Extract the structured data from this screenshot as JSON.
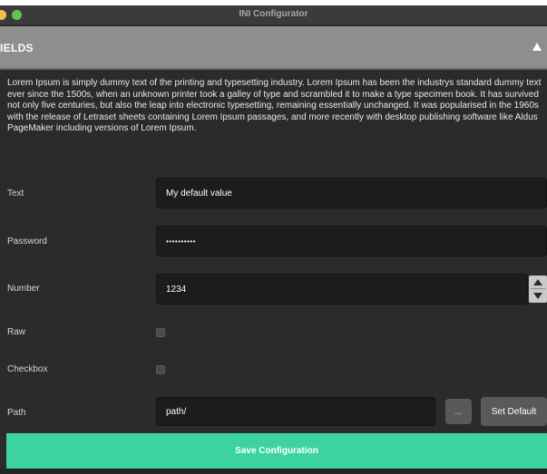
{
  "window": {
    "title": "INI Configurator"
  },
  "section": {
    "title": "IELDS"
  },
  "description": "Lorem Ipsum is simply dummy text of the printing and typesetting industry. Lorem Ipsum has been the industrys standard dummy text ever since the 1500s, when an unknown printer took a galley of type and scrambled it to make a type specimen book. It has survived not only five centuries, but also the leap into electronic typesetting, remaining essentially unchanged. It was popularised in the 1960s with the release of Letraset sheets containing Lorem Ipsum passages, and more recently with desktop publishing software like Aldus PageMaker including versions of Lorem Ipsum.",
  "fields": {
    "text": {
      "label": "Text",
      "value": "My default value"
    },
    "password": {
      "label": "Password",
      "value": "••••••••••"
    },
    "number": {
      "label": "Number",
      "value": "1234"
    },
    "raw": {
      "label": "Raw",
      "checked": false
    },
    "checkbox": {
      "label": "Checkbox",
      "checked": false
    },
    "path": {
      "label": "Path",
      "value": "path/",
      "browse_label": "...",
      "set_default_label": "Set Default"
    }
  },
  "save_label": "Save Configuration",
  "colors": {
    "accent": "#3dd3a0",
    "header": "#8e8e8e",
    "background": "#2b2b2b"
  }
}
